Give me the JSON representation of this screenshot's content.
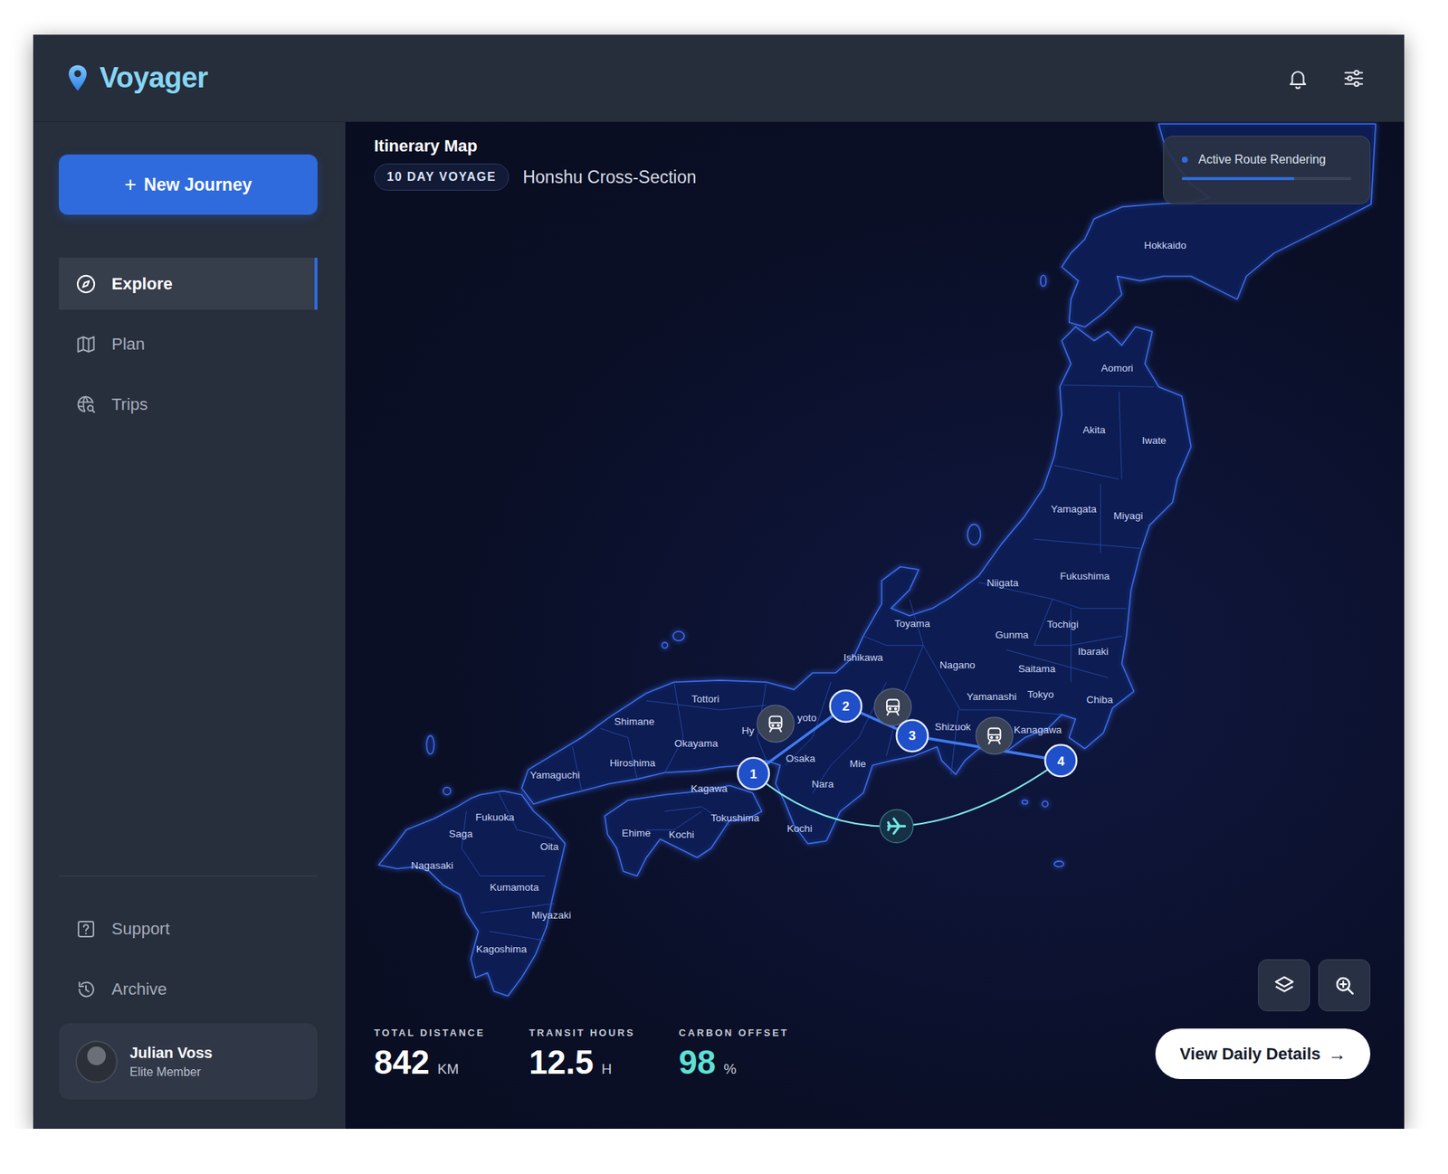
{
  "app": {
    "name": "Voyager"
  },
  "sidebar": {
    "new_journey": {
      "icon": "+",
      "label": "New Journey"
    },
    "nav": [
      {
        "label": "Explore",
        "selected": true
      },
      {
        "label": "Plan",
        "selected": false
      },
      {
        "label": "Trips",
        "selected": false
      }
    ],
    "footer_nav": [
      {
        "label": "Support"
      },
      {
        "label": "Archive"
      }
    ],
    "user": {
      "name": "Julian Voss",
      "tier": "Elite Member"
    }
  },
  "map": {
    "title": "Itinerary Map",
    "badge": "10 DAY VOYAGE",
    "subtitle": "Honshu Cross-Section",
    "status": {
      "label": "Active Route Rendering",
      "level": 0.66
    },
    "regions": [
      "Hokkaido",
      "Aomori",
      "Akita",
      "Iwate",
      "Yamagata",
      "Miyagi",
      "Niigata",
      "Fukushima",
      "Toyama",
      "Gunma",
      "Tochigi",
      "Ishikawa",
      "Nagano",
      "Ibaraki",
      "Saitama",
      "Yamanashi",
      "Tokyo",
      "Chiba",
      "Kanagawa",
      "Shizuok",
      "Hy",
      "yoto",
      "Tottori",
      "Shimane",
      "Okayama",
      "Hiroshima",
      "Yamaguchi",
      "Osaka",
      "Mie",
      "Nara",
      "Kagawa",
      "Tokushima",
      "Kochi",
      "Ehime",
      "Kochi",
      "Fukuoka",
      "Saga",
      "Oita",
      "Nagasaki",
      "Kumamota",
      "Miyazaki",
      "Kagoshima"
    ],
    "stops": [
      {
        "label": "1"
      },
      {
        "label": "2"
      },
      {
        "label": "3"
      },
      {
        "label": "4"
      }
    ],
    "legs": [
      {
        "kind": "rail"
      },
      {
        "kind": "rail"
      },
      {
        "kind": "rail"
      },
      {
        "kind": "flight"
      }
    ],
    "stats": [
      {
        "label": "TOTAL DISTANCE",
        "value": "842",
        "unit": "KM",
        "highlight": false
      },
      {
        "label": "TRANSIT HOURS",
        "value": "12.5",
        "unit": "H",
        "highlight": false
      },
      {
        "label": "CARBON OFFSET",
        "value": "98",
        "unit": "%",
        "highlight": true
      }
    ],
    "details_button": {
      "label": "View Daily Details",
      "icon": "→"
    }
  }
}
